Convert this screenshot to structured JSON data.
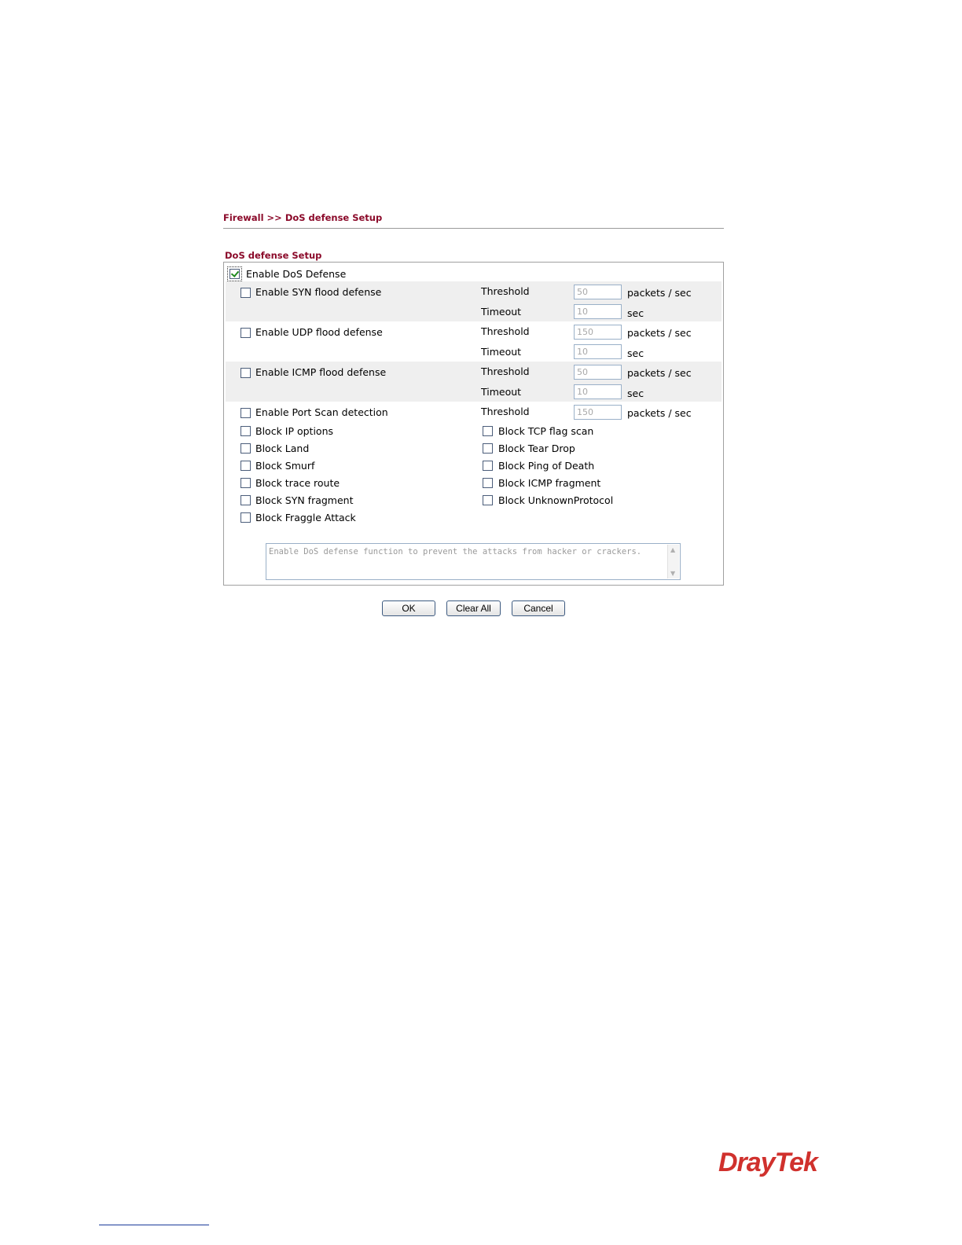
{
  "breadcrumb": "Firewall >> DoS defense Setup",
  "section_title": "DoS defense Setup",
  "enable_dos": {
    "label": "Enable DoS Defense",
    "checked": true
  },
  "flood": {
    "syn": {
      "label": "Enable SYN flood defense",
      "threshold_label": "Threshold",
      "threshold": "50",
      "threshold_unit": "packets / sec",
      "timeout_label": "Timeout",
      "timeout": "10",
      "timeout_unit": "sec"
    },
    "udp": {
      "label": "Enable UDP flood defense",
      "threshold_label": "Threshold",
      "threshold": "150",
      "threshold_unit": "packets / sec",
      "timeout_label": "Timeout",
      "timeout": "10",
      "timeout_unit": "sec"
    },
    "icmp": {
      "label": "Enable ICMP flood defense",
      "threshold_label": "Threshold",
      "threshold": "50",
      "threshold_unit": "packets / sec",
      "timeout_label": "Timeout",
      "timeout": "10",
      "timeout_unit": "sec"
    },
    "portscan": {
      "label": "Enable Port Scan detection",
      "threshold_label": "Threshold",
      "threshold": "150",
      "threshold_unit": "packets / sec"
    }
  },
  "blocks_left": [
    "Block IP options",
    "Block Land",
    "Block Smurf",
    "Block trace route",
    "Block SYN fragment",
    "Block Fraggle Attack"
  ],
  "blocks_right": [
    "Block TCP flag scan",
    "Block Tear Drop",
    "Block Ping of Death",
    "Block ICMP fragment",
    "Block UnknownProtocol"
  ],
  "note": "Enable DoS defense function to prevent the attacks from hacker or crackers.",
  "buttons": {
    "ok": "OK",
    "clear_all": "Clear All",
    "cancel": "Cancel"
  },
  "logo": "DrayTek"
}
